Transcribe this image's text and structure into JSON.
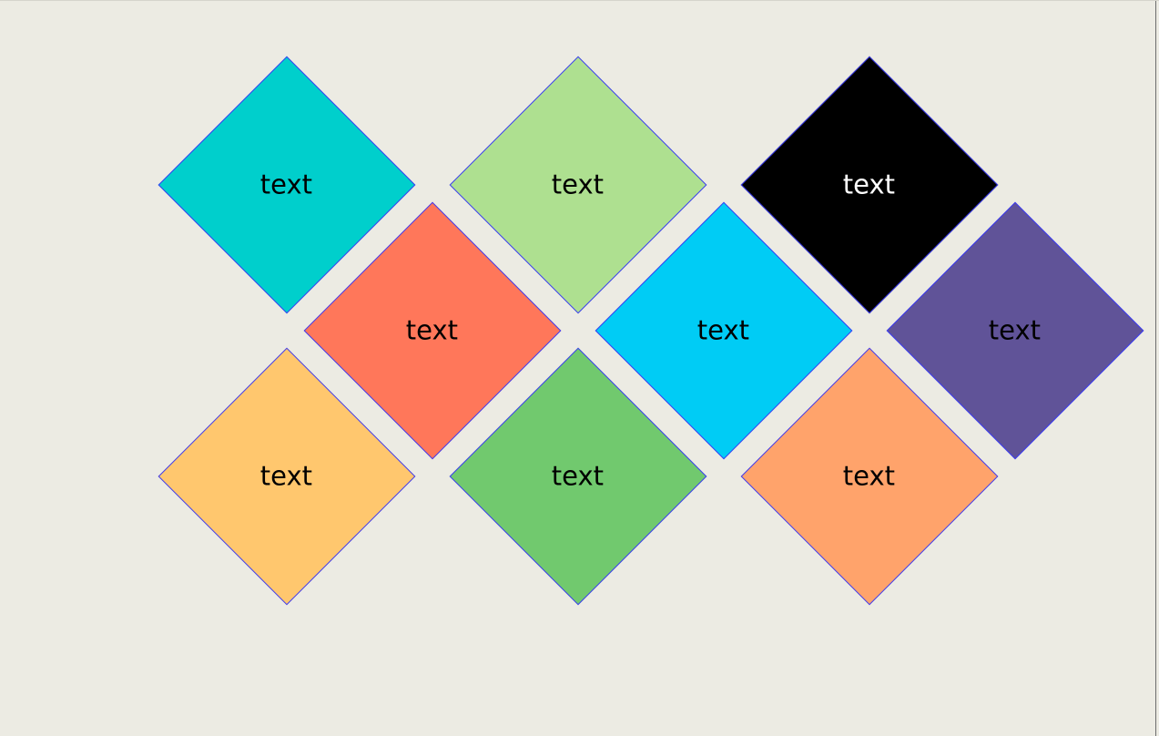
{
  "tiles": [
    {
      "label": "text",
      "color": "#00CFCC",
      "text_color": "#000000"
    },
    {
      "label": "text",
      "color": "#AEE090",
      "text_color": "#000000"
    },
    {
      "label": "text",
      "color": "#000000",
      "text_color": "#FFFFFF"
    },
    {
      "label": "text",
      "color": "#FF775A",
      "text_color": "#000000"
    },
    {
      "label": "text",
      "color": "#00CCF5",
      "text_color": "#000000"
    },
    {
      "label": "text",
      "color": "#605398",
      "text_color": "#000000"
    },
    {
      "label": "text",
      "color": "#FFC76E",
      "text_color": "#000000"
    },
    {
      "label": "text",
      "color": "#71C96E",
      "text_color": "#000000"
    },
    {
      "label": "text",
      "color": "#FFA36B",
      "text_color": "#000000"
    }
  ]
}
